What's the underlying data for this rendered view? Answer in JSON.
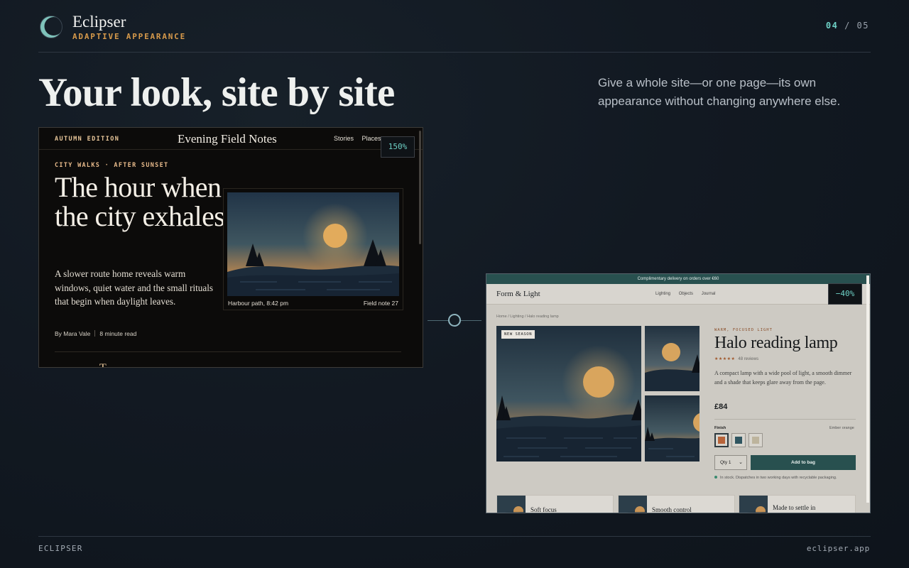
{
  "brand": {
    "name": "Eclipser",
    "tagline": "ADAPTIVE APPEARANCE"
  },
  "pager": {
    "current": "04",
    "separator": "/",
    "total": "05"
  },
  "hero": {
    "title": "Your look, site by site",
    "lede": "Give a whole site—or one page—its own appearance without changing anywhere else."
  },
  "dark_site": {
    "edition": "AUTUMN EDITION",
    "brand": "Evening Field Notes",
    "nav": [
      "Stories",
      "Places"
    ],
    "zoom_badge": "150%",
    "kicker": "CITY WALKS · AFTER SUNSET",
    "headline": "The hour when the city exhales",
    "body": "A slower route home reveals warm windows, quiet water and the small rituals that begin when daylight leaves.",
    "author": "By Mara Vale",
    "read_time": "8 minute read",
    "caption_left": "Harbour path, 8:42 pm",
    "caption_right": "Field note 27",
    "next_initial": "T"
  },
  "light_site": {
    "banner": "Complimentary delivery on orders over €60",
    "brand": "Form & Light",
    "nav": [
      "Lighting",
      "Objects",
      "Journal"
    ],
    "discount_badge": "−40%",
    "breadcrumb": "Home / Lighting / Halo reading lamp",
    "badge": "NEW SEASON",
    "kicker": "WARM, FOCUSED LIGHT",
    "title": "Halo reading lamp",
    "rating": "★★★★★",
    "reviews": "48 reviews",
    "description": "A compact lamp with a wide pool of light, a smooth dimmer and a shade that keeps glare away from the page.",
    "price": "£84",
    "finish_label": "Finish",
    "finish_value": "Ember orange",
    "swatches": [
      "#b8643a",
      "#2f5560",
      "#bdb49d"
    ],
    "qty": "Qty 1",
    "add_to_bag": "Add to bag",
    "stock": "In stock. Dispatches in two working days with recyclable packaging.",
    "cards": [
      "Soft focus",
      "Smooth control",
      "Made to settle in"
    ]
  },
  "footer": {
    "left": "ECLIPSER",
    "right": "eclipser.app"
  },
  "colors": {
    "accent": "#6ed1c6",
    "brand_orange": "#d79a4b",
    "store_green": "#28504f"
  }
}
